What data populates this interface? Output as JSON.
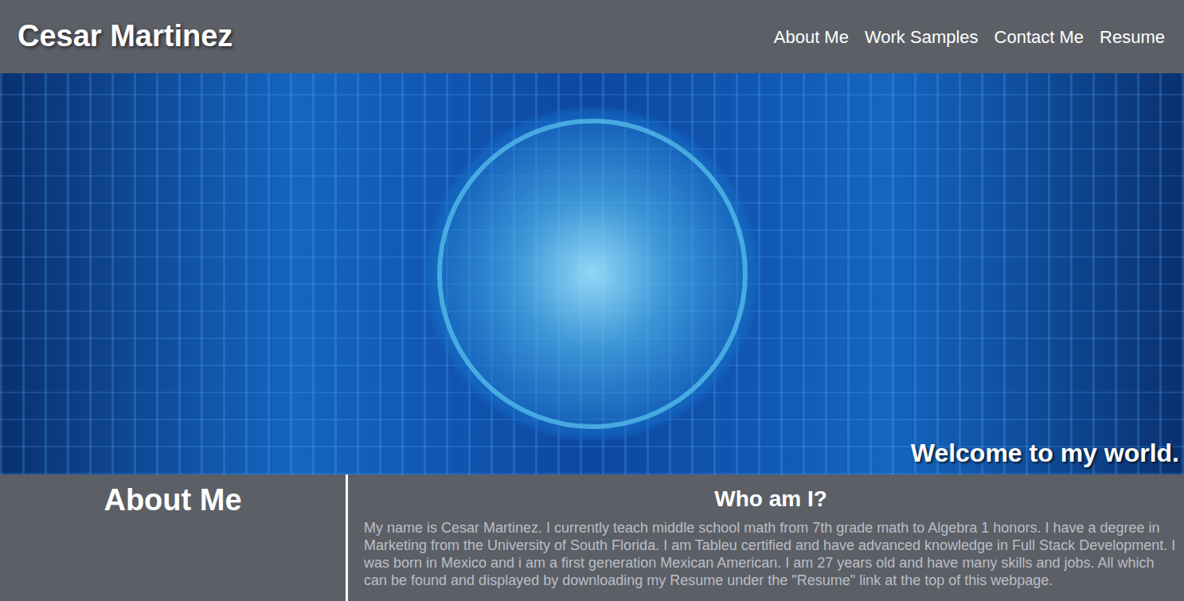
{
  "header": {
    "title": "Cesar Martinez"
  },
  "nav": [
    {
      "label": "About Me"
    },
    {
      "label": "Work Samples"
    },
    {
      "label": "Contact Me"
    },
    {
      "label": "Resume"
    }
  ],
  "hero": {
    "caption": "Welcome to my world."
  },
  "about": {
    "heading": "About Me",
    "subheading": "Who am I?",
    "body": "My name is Cesar Martinez. I currently teach middle school math from 7th grade math to Algebra 1 honors. I have a degree in Marketing from the University of South Florida. I am Tableu certified and have advanced knowledge in Full Stack Development. I was born in Mexico and i am a first generation Mexican American. I am 27 years old and have many skills and jobs. All which can be found and displayed by downloading my Resume under the \"Resume\" link at the top of this webpage."
  }
}
